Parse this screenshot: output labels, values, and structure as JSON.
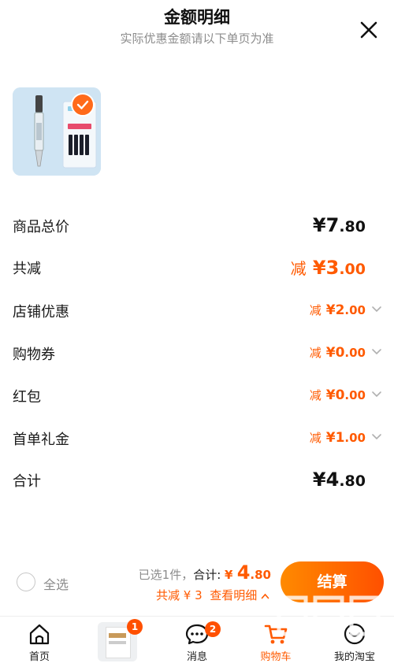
{
  "header": {
    "title": "金额明细",
    "subtitle": "实际优惠金额请以下单页为准"
  },
  "rows": {
    "total_price": {
      "label": "商品总价",
      "currency": "¥",
      "int": "7",
      "cents": ".80"
    },
    "total_reduce": {
      "label": "共减",
      "prefix": "减",
      "currency": "¥",
      "int": "3",
      "cents": ".00"
    },
    "shop_discount": {
      "label": "店铺优惠",
      "prefix": "减",
      "currency": "¥",
      "int": "2",
      "cents": ".00"
    },
    "voucher": {
      "label": "购物券",
      "prefix": "减",
      "currency": "¥",
      "int": "0",
      "cents": ".00"
    },
    "red_packet": {
      "label": "红包",
      "prefix": "减",
      "currency": "¥",
      "int": "0",
      "cents": ".00"
    },
    "first_order_gift": {
      "label": "首单礼金",
      "prefix": "减",
      "currency": "¥",
      "int": "1",
      "cents": ".00"
    },
    "sum": {
      "label": "合计",
      "currency": "¥",
      "int": "4",
      "cents": ".80"
    }
  },
  "footer": {
    "select_all": "全选",
    "selected_text": "已选1件，",
    "sum_label": "合计:",
    "currency": "¥",
    "price_int": "4",
    "price_cents": ".80",
    "reduce_text": "共减 ¥ 3",
    "detail_link": "查看明细",
    "checkout_label": "结算"
  },
  "tabs": [
    {
      "label": "首页"
    },
    {
      "label": "",
      "badge": "1"
    },
    {
      "label": "消息",
      "badge": "2"
    },
    {
      "label": "购物车"
    },
    {
      "label": "我的淘宝"
    }
  ],
  "colors": {
    "accent": "#ff5a00",
    "thumb_bg": "#cfe4f3"
  },
  "watermark": {
    "text": "值 什么值得买",
    "sub": "zhizhizhi.com"
  }
}
